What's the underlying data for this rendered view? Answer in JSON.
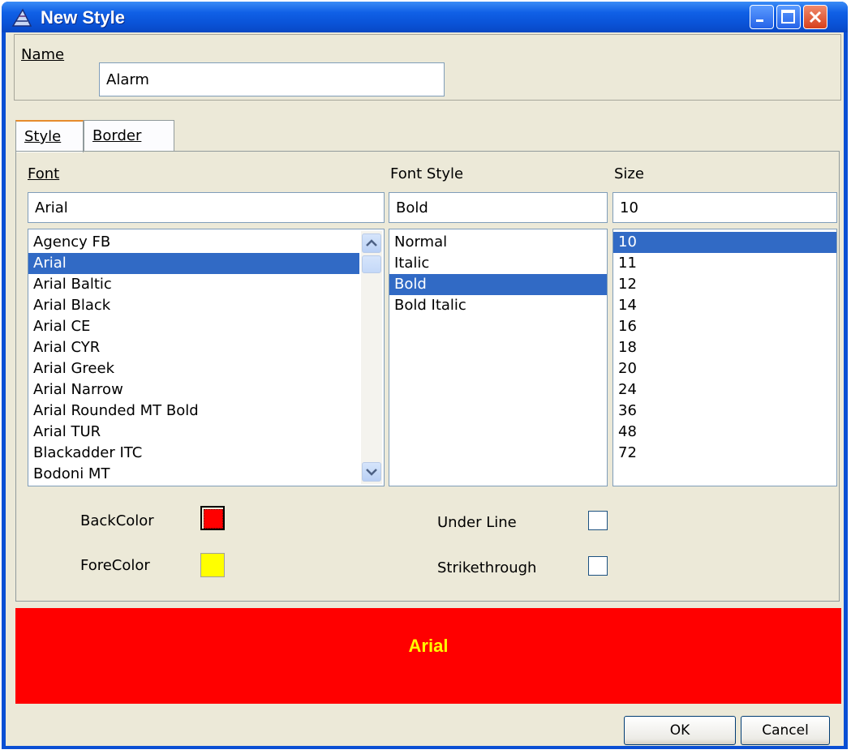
{
  "window": {
    "title": "New Style"
  },
  "name": {
    "label": "Name",
    "value": "Alarm"
  },
  "tabs": [
    {
      "label": "Style",
      "active": true
    },
    {
      "label": "Border",
      "active": false
    }
  ],
  "font": {
    "label": "Font",
    "value": "Arial",
    "items": [
      "Agency FB",
      "Arial",
      "Arial Baltic",
      "Arial Black",
      "Arial CE",
      "Arial CYR",
      "Arial Greek",
      "Arial Narrow",
      "Arial Rounded MT Bold",
      "Arial TUR",
      "Blackadder ITC",
      "Bodoni MT"
    ],
    "selected": "Arial"
  },
  "font_style": {
    "label": "Font Style",
    "value": "Bold",
    "items": [
      "Normal",
      "Italic",
      "Bold",
      "Bold Italic"
    ],
    "selected": "Bold"
  },
  "size": {
    "label": "Size",
    "value": "10",
    "items": [
      "10",
      "11",
      "12",
      "14",
      "16",
      "18",
      "20",
      "24",
      "36",
      "48",
      "72"
    ],
    "selected": "10"
  },
  "colors": {
    "back": {
      "label": "BackColor",
      "color": "#ff0000"
    },
    "fore": {
      "label": "ForeColor",
      "color": "#ffff00"
    }
  },
  "effects": {
    "underline": {
      "label": "Under Line",
      "checked": false
    },
    "strikethrough": {
      "label": "Strikethrough",
      "checked": false
    }
  },
  "preview": {
    "text": "Arial",
    "background": "#ff0000",
    "foreground": "#ffff00"
  },
  "buttons": {
    "ok": "OK",
    "cancel": "Cancel"
  },
  "theme": {
    "selection": "#316ac5",
    "titlebar": "#0a53d8",
    "face": "#ece9d8"
  }
}
